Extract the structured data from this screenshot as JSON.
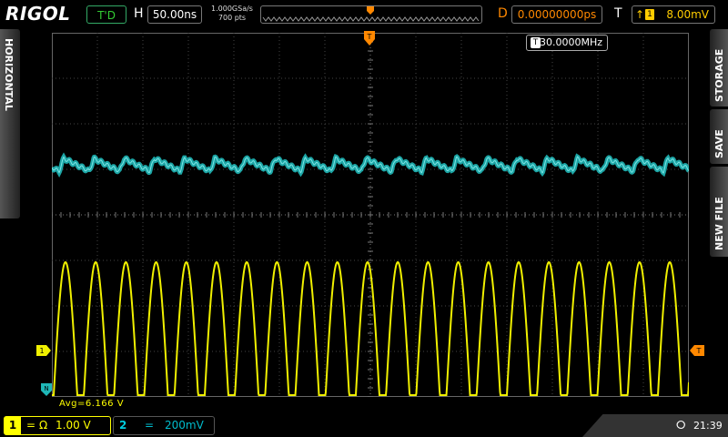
{
  "header": {
    "brand": "RIGOL",
    "run_state": "T'D",
    "timebase_label": "H",
    "timebase_value": "50.00ns",
    "sample_rate": "1.000GSa/s",
    "memory_depth": "700 pts",
    "delay_label": "D",
    "delay_value": "0.00000000ps",
    "trigger_label": "T",
    "trigger_source": "1",
    "trigger_level": "8.00mV"
  },
  "left_panel": {
    "label": "HORIZONTAL"
  },
  "right_panel": {
    "labels": [
      "STORAGE",
      "SAVE",
      "NEW FILE"
    ]
  },
  "screen": {
    "frequency_counter": "30.0000MHz",
    "frequency_badge": "T",
    "measurement": "Avg=6.166 V",
    "ch1_marker": "1",
    "ch2_marker": "N",
    "trigger_marker": "T",
    "trigger_position_marker": "T"
  },
  "footer": {
    "ch1": {
      "number": "1",
      "coupling": "=",
      "impedance": "Ω",
      "scale": "1.00 V"
    },
    "ch2": {
      "number": "2",
      "coupling": "=",
      "scale": "200mV"
    },
    "usb_icon": "usb-icon",
    "time": "21:39"
  },
  "colors": {
    "ch1": "#f0f000",
    "ch2": "#1fb7b7",
    "trigger": "#ff8800",
    "grid": "#444444"
  }
}
